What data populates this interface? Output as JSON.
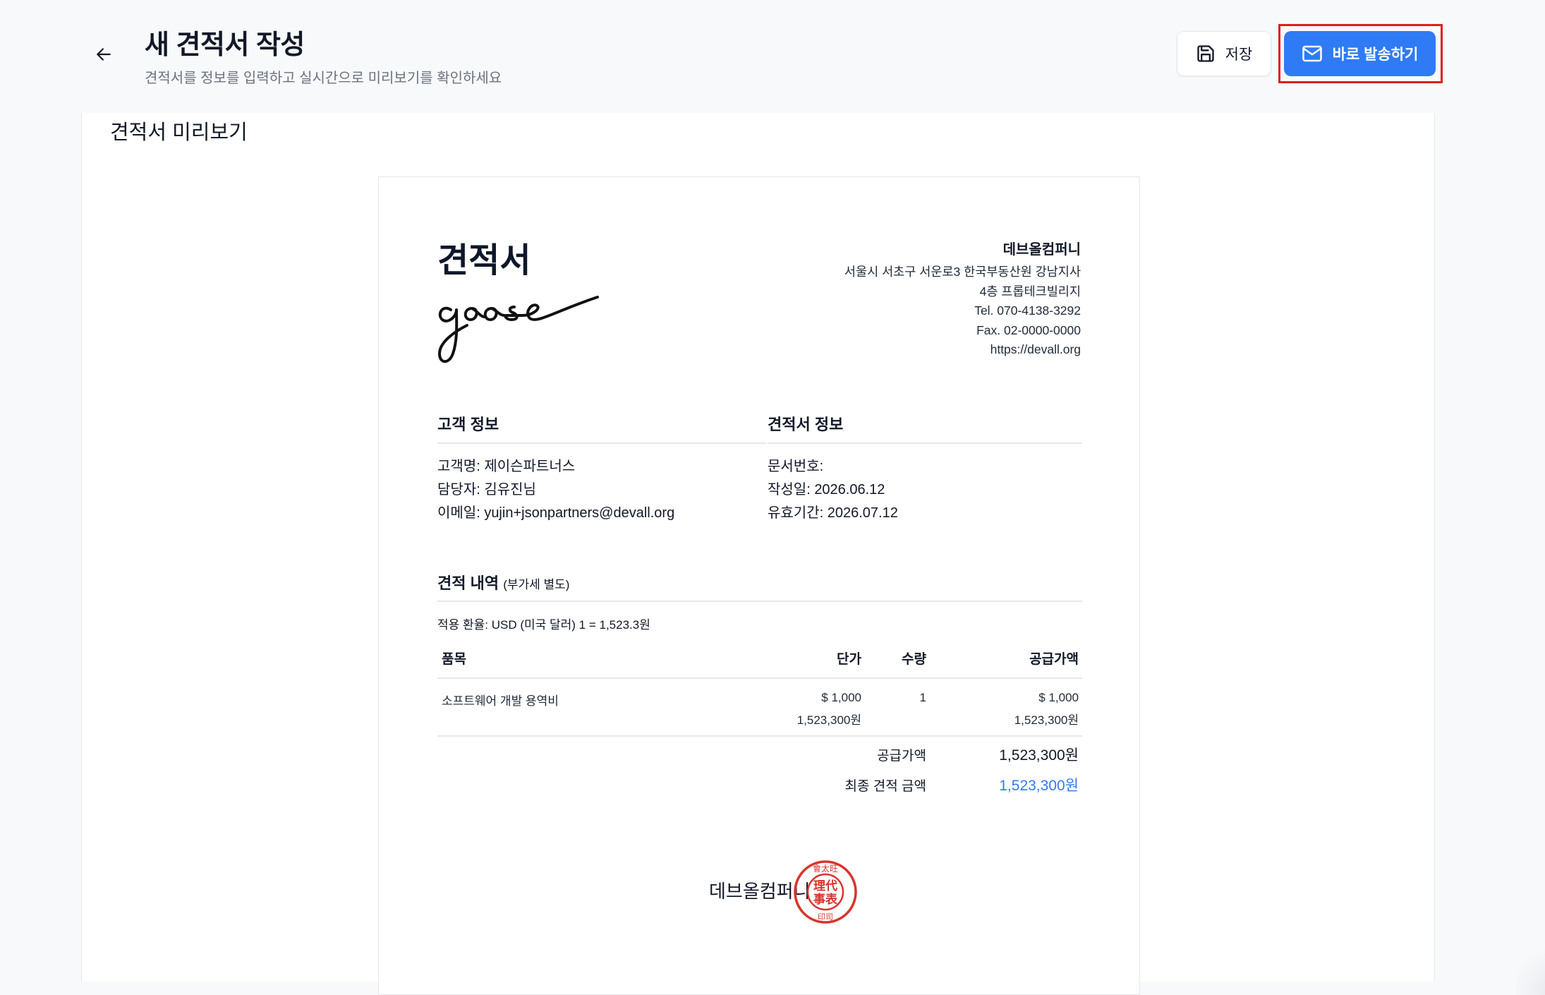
{
  "header": {
    "title": "새 견적서 작성",
    "subtitle": "견적서를 정보를 입력하고 실시간으로 미리보기를 확인하세요",
    "save_label": "저장",
    "send_label": "바로 발송하기"
  },
  "preview": {
    "panel_title": "견적서 미리보기",
    "doc_title": "견적서",
    "signature_text": "goose",
    "company": {
      "name": "데브올컴퍼니",
      "address_line1": "서울시 서초구 서운로3 한국부동산원 강남지사",
      "address_line2": "4층 프롭테크빌리지",
      "tel": "Tel. 070-4138-3292",
      "fax": "Fax. 02-0000-0000",
      "website": "https://devall.org"
    },
    "customer": {
      "heading": "고객 정보",
      "name_line": "고객명: 제이슨파트너스",
      "contact_line": "담당자: 김유진님",
      "email_line": "이메일: yujin+jsonpartners@devall.org"
    },
    "quote_info": {
      "heading": "견적서 정보",
      "doc_no_line": "문서번호:",
      "date_line": "작성일: 2026.06.12",
      "valid_line": "유효기간: 2026.07.12"
    },
    "items_section": {
      "heading": "견적 내역",
      "heading_note": "(부가세 별도)",
      "exchange_note": "적용 환율: USD (미국 달러) 1 = 1,523.3원",
      "columns": {
        "item": "품목",
        "unit_price": "단가",
        "qty": "수량",
        "supply": "공급가액"
      },
      "rows": [
        {
          "item": "소프트웨어 개발 용역비",
          "unit_price_usd": "$ 1,000",
          "unit_price_krw": "1,523,300원",
          "qty": "1",
          "supply_usd": "$ 1,000",
          "supply_krw": "1,523,300원"
        }
      ],
      "supply_total_label": "공급가액",
      "supply_total_value": "1,523,300원",
      "final_label": "최종 견적 금액",
      "final_value": "1,523,300원"
    },
    "signature_company": "데브올컴퍼니",
    "seal": {
      "top_text": "會太旺",
      "center_line1": "理代",
      "center_line2": "事表",
      "bottom_text": "印司"
    }
  },
  "colors": {
    "accent": "#2f7bf5",
    "highlight_border": "#e11d1d",
    "seal_red": "#d9342b"
  }
}
